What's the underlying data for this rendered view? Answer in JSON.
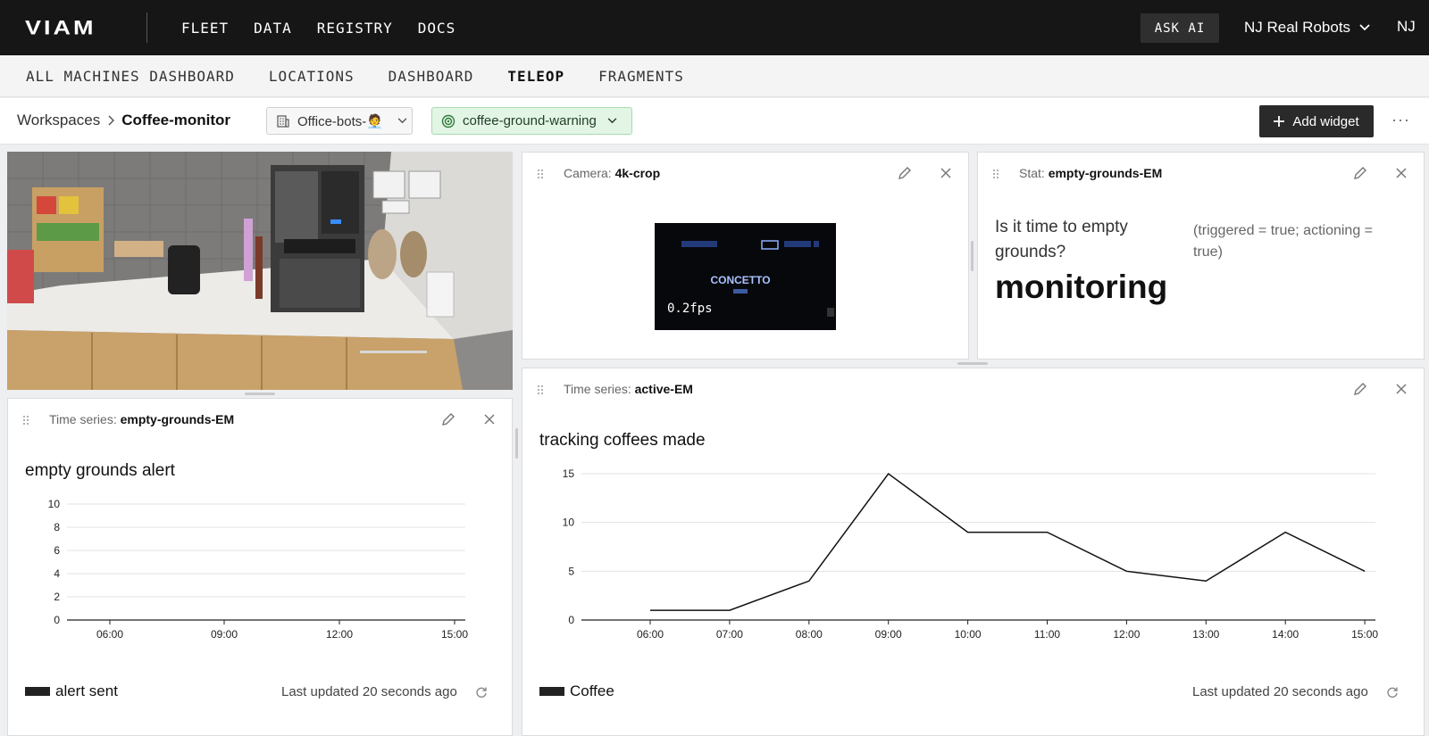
{
  "topbar": {
    "logo": "VIAM",
    "nav": [
      "FLEET",
      "DATA",
      "REGISTRY",
      "DOCS"
    ],
    "ask_ai": "ASK AI",
    "org": "NJ Real Robots",
    "user_initials": "NJ"
  },
  "subnav": {
    "items": [
      "ALL MACHINES DASHBOARD",
      "LOCATIONS",
      "DASHBOARD",
      "TELEOP",
      "FRAGMENTS"
    ],
    "active": "TELEOP"
  },
  "workspace": {
    "breadcrumb_root": "Workspaces",
    "breadcrumb_current": "Coffee-monitor",
    "location_select": "Office-bots-🧑‍💼",
    "machine_select": "coffee-ground-warning",
    "add_widget": "Add widget"
  },
  "widgets": {
    "camera": {
      "kind": "Camera:",
      "name": "4k-crop",
      "fps": "0.2fps",
      "screen_text": "CONCETTO"
    },
    "stat": {
      "kind": "Stat:",
      "name": "empty-grounds-EM",
      "question": "Is it time to empty grounds?",
      "note": "(triggered = true; actioning = true)",
      "value": "monitoring"
    },
    "ts_grounds": {
      "kind": "Time series:",
      "name": "empty-grounds-EM",
      "title": "empty grounds alert",
      "legend": "alert sent",
      "updated": "Last updated 20 seconds ago"
    },
    "ts_coffee": {
      "kind": "Time series:",
      "name": "active-EM",
      "title": "tracking coffees made",
      "legend": "Coffee",
      "updated": "Last updated 20 seconds ago"
    }
  },
  "chart_data": [
    {
      "type": "line",
      "title": "empty grounds alert",
      "x_ticks": [
        "06:00",
        "09:00",
        "12:00",
        "15:00"
      ],
      "y_ticks": [
        0,
        2,
        4,
        6,
        8,
        10
      ],
      "ylim": [
        0,
        10
      ],
      "series": [
        {
          "name": "alert sent",
          "x": [],
          "values": []
        }
      ],
      "grid": true,
      "legend": "bottom-left"
    },
    {
      "type": "line",
      "title": "tracking coffees made",
      "x_ticks": [
        "06:00",
        "07:00",
        "08:00",
        "09:00",
        "10:00",
        "11:00",
        "12:00",
        "13:00",
        "14:00",
        "15:00"
      ],
      "y_ticks": [
        0,
        5,
        10,
        15
      ],
      "ylim": [
        0,
        15
      ],
      "series": [
        {
          "name": "Coffee",
          "x": [
            "06:00",
            "07:00",
            "08:00",
            "09:00",
            "10:00",
            "11:00",
            "12:00",
            "13:00",
            "14:00",
            "15:00"
          ],
          "values": [
            1,
            1,
            4,
            15,
            9,
            9,
            5,
            4,
            9,
            5
          ]
        }
      ],
      "grid": true,
      "legend": "bottom-left"
    }
  ],
  "colors": {
    "topbar": "#161616",
    "machine_chip_bg": "#e3f5e5",
    "line": "#111111"
  }
}
